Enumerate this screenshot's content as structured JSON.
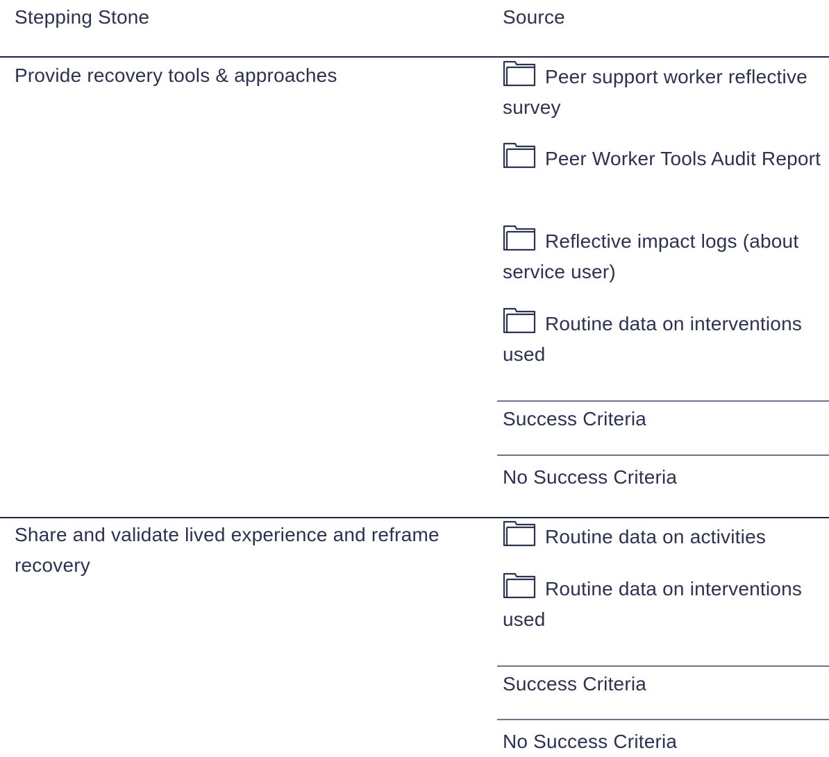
{
  "header": {
    "stepping_stone": "Stepping Stone",
    "source": "Source"
  },
  "rows": [
    {
      "stepping_stone": "Provide recovery tools & approaches",
      "sources": [
        {
          "icon": "folder-icon",
          "label": "Peer support worker reflective survey"
        },
        {
          "icon": "folder-icon",
          "label": "Peer Worker Tools Audit Report"
        },
        {
          "icon": "folder-icon",
          "label": "Reflective impact logs (about service user)"
        },
        {
          "icon": "folder-icon",
          "label": "Routine data on interventions used"
        }
      ],
      "success_criteria_heading": "Success Criteria",
      "success_criteria_value": "No Success Criteria"
    },
    {
      "stepping_stone": "Share and validate lived experience and reframe recovery",
      "sources": [
        {
          "icon": "folder-icon",
          "label": "Routine data on activities"
        },
        {
          "icon": "folder-icon",
          "label": "Routine data on interventions used"
        }
      ],
      "success_criteria_heading": "Success Criteria",
      "success_criteria_value": "No Success Criteria"
    }
  ],
  "colors": {
    "text": "#2b3350",
    "rule": "#1f2540",
    "sub_rule": "#6e7389"
  }
}
